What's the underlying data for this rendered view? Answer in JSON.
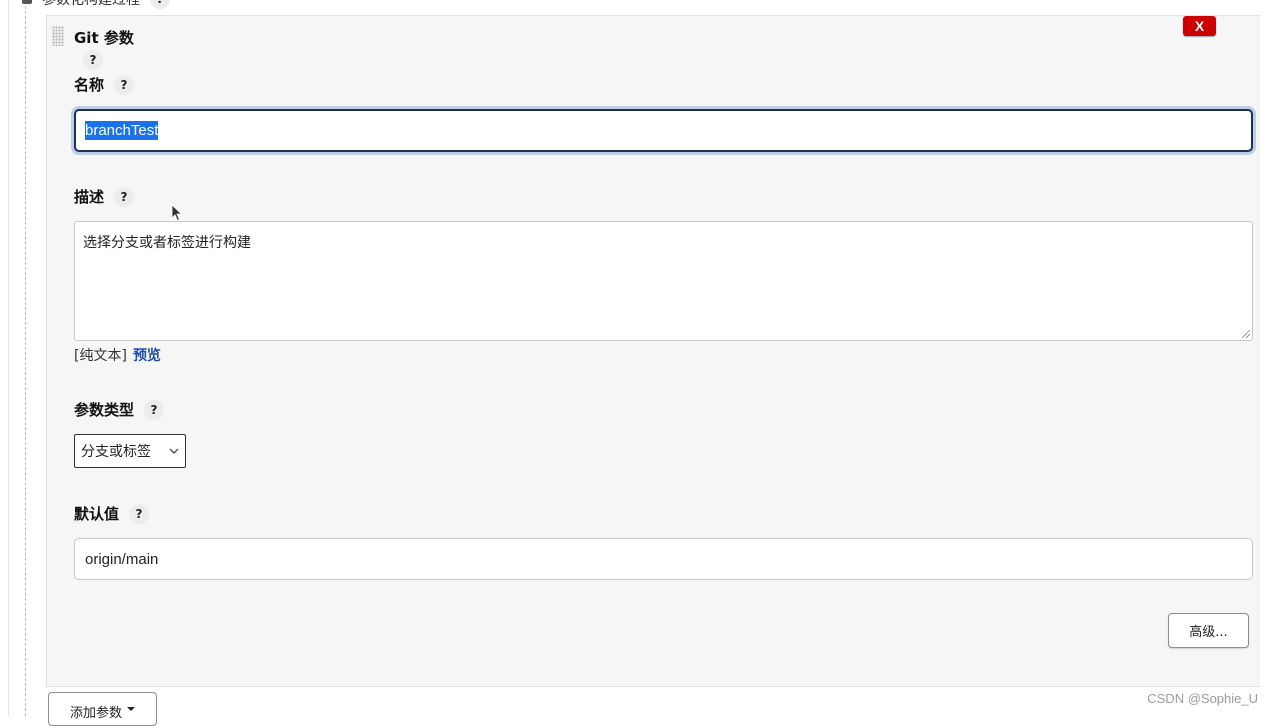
{
  "top_row": {
    "label": "参数化构建过程",
    "help": "?"
  },
  "panel": {
    "title": "Git 参数",
    "title_help": "?",
    "close_label": "X"
  },
  "name_field": {
    "label": "名称",
    "help": "?",
    "value": "branchTest"
  },
  "description_field": {
    "label": "描述",
    "help": "?",
    "value": "选择分支或者标签进行构建",
    "mode_label": "[纯文本]",
    "preview_link": "预览"
  },
  "param_type": {
    "label": "参数类型",
    "help": "?",
    "selected": "分支或标签"
  },
  "default_value": {
    "label": "默认值",
    "help": "?",
    "value": "origin/main"
  },
  "buttons": {
    "advanced": "高级...",
    "add_param": "添加参数"
  },
  "watermark": "CSDN @Sophie_U",
  "colors": {
    "close_red": "#cc0000",
    "link_blue": "#1b4fa3",
    "focus_ring": "#b9cfea",
    "selection": "#1a73e8"
  }
}
